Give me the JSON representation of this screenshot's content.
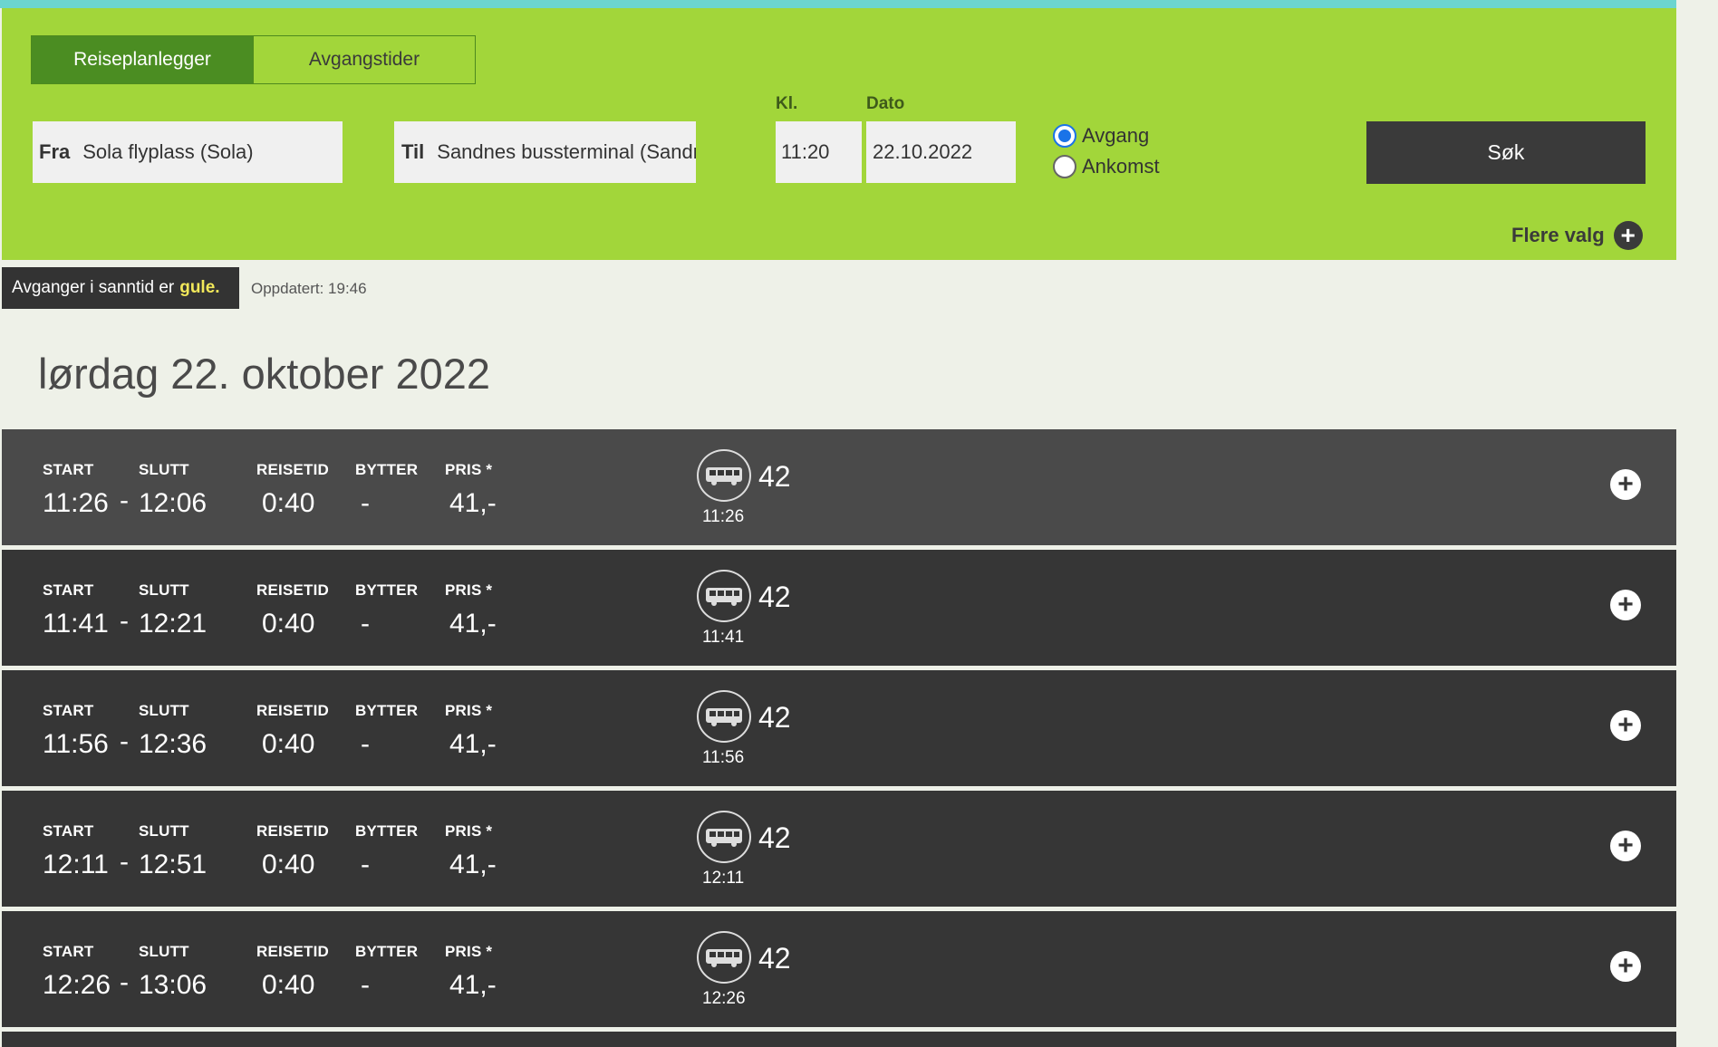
{
  "tabs": [
    {
      "label": "Reiseplanlegger",
      "active": true
    },
    {
      "label": "Avgangstider",
      "active": false
    }
  ],
  "search": {
    "from_label": "Fra",
    "from_value": "Sola flyplass (Sola)",
    "to_label": "Til",
    "to_value": "Sandnes bussterminal (Sandnes)",
    "time_label": "Kl.",
    "time_value": "11:20",
    "date_label": "Dato",
    "date_value": "22.10.2022",
    "radio_departure": "Avgang",
    "radio_arrival": "Ankomst",
    "selected": "Avgang",
    "submit_label": "Søk",
    "more_label": "Flere valg"
  },
  "info": {
    "realtime_text": "Avganger i sanntid er",
    "realtime_highlight": "gule.",
    "updated": "Oppdatert: 19:46"
  },
  "day_title": "lørdag 22. oktober 2022",
  "headers": {
    "start": "START",
    "slutt": "SLUTT",
    "reisetid": "REISETID",
    "bytter": "BYTTER",
    "pris": "PRIS *"
  },
  "trips": [
    {
      "start": "11:26",
      "end": "12:06",
      "duration": "0:40",
      "changes": "-",
      "price": "41,-",
      "line": "42",
      "dep": "11:26"
    },
    {
      "start": "11:41",
      "end": "12:21",
      "duration": "0:40",
      "changes": "-",
      "price": "41,-",
      "line": "42",
      "dep": "11:41"
    },
    {
      "start": "11:56",
      "end": "12:36",
      "duration": "0:40",
      "changes": "-",
      "price": "41,-",
      "line": "42",
      "dep": "11:56"
    },
    {
      "start": "12:11",
      "end": "12:51",
      "duration": "0:40",
      "changes": "-",
      "price": "41,-",
      "line": "42",
      "dep": "12:11"
    },
    {
      "start": "12:26",
      "end": "13:06",
      "duration": "0:40",
      "changes": "-",
      "price": "41,-",
      "line": "42",
      "dep": "12:26"
    }
  ],
  "colors": {
    "panel_green": "#a2d63a",
    "active_tab": "#4b8d22",
    "row_dark": "#363636",
    "realtime_yellow": "#f2e85a"
  }
}
